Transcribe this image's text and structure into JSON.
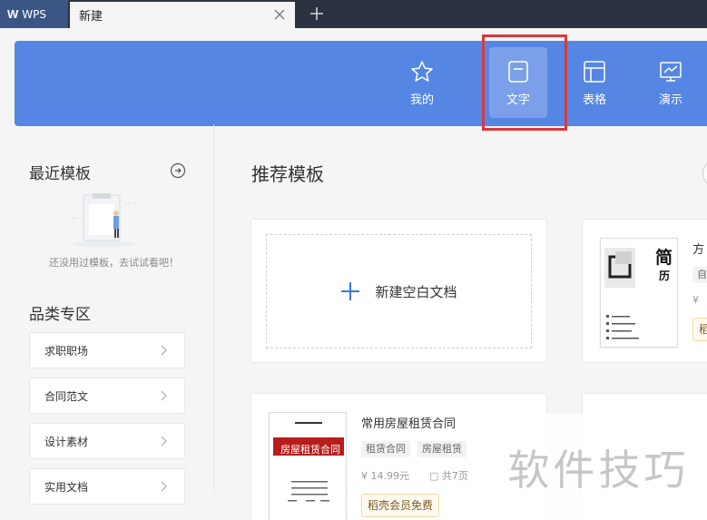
{
  "tabs": {
    "app_name": "WPS",
    "doc_tab_label": "新建"
  },
  "nav": {
    "items": [
      {
        "label": "我的",
        "icon": "star-icon"
      },
      {
        "label": "文字",
        "icon": "document-icon"
      },
      {
        "label": "表格",
        "icon": "spreadsheet-icon"
      },
      {
        "label": "演示",
        "icon": "presentation-icon"
      }
    ],
    "active": "文字"
  },
  "sidebar": {
    "recent_title": "最近模板",
    "recent_empty_text": "还没用过模板，去试试看吧！",
    "category_title": "品类专区",
    "categories": [
      "求职职场",
      "合同范文",
      "设计素材",
      "实用文档"
    ]
  },
  "main": {
    "recommend_title": "推荐模板",
    "blank_card_label": "新建空白文档",
    "templates": [
      {
        "title": "常用房屋租赁合同",
        "thumb_label": "房屋租赁合同",
        "tags": [
          "租赁合同",
          "房屋租赁"
        ],
        "price": "14.99元",
        "pages": "共7页",
        "vip": "稻壳会员免费"
      },
      {
        "title": "方",
        "thumb_label": "简",
        "thumb_label2": "历",
        "tags": [
          "自"
        ],
        "price": "",
        "pages": "",
        "vip": "稻"
      }
    ]
  },
  "watermark": "软件技巧",
  "colors": {
    "banner": "#5686e3",
    "tabbar": "#2c3340",
    "highlight": "#d9383c",
    "accent": "#3b78d8"
  }
}
